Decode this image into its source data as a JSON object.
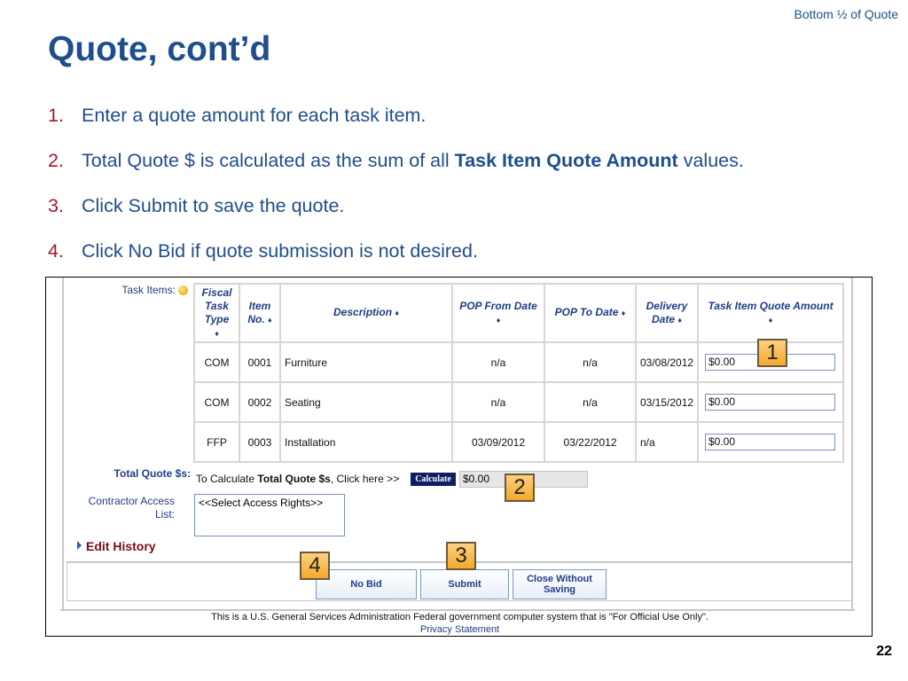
{
  "slide": {
    "section_note": "Bottom ½ of Quote",
    "title": "Quote, cont’d",
    "page_number": "22",
    "steps": [
      {
        "num": "1.",
        "text": "Enter a quote amount for each task item."
      },
      {
        "num": "2.",
        "text_before": "Total Quote $ is calculated as the sum of all ",
        "bold": "Task Item Quote Amount",
        "text_after": " values."
      },
      {
        "num": "3.",
        "text": "Click Submit to save the quote."
      },
      {
        "num": "4.",
        "text": "Click No Bid if quote submission is not desired."
      }
    ]
  },
  "form": {
    "task_items_label": "Task Items:",
    "columns": {
      "fiscal_task_type": "Fiscal Task Type",
      "item_no": "Item No.",
      "description": "Description",
      "pop_from": "POP From Date",
      "pop_to": "POP To Date",
      "delivery_date": "Delivery Date",
      "quote_amount": "Task Item Quote Amount",
      "sort_glyph": "♦"
    },
    "rows": [
      {
        "type": "COM",
        "item_no": "0001",
        "description": "Furniture",
        "pop_from": "n/a",
        "pop_to": "n/a",
        "delivery": "03/08/2012",
        "amount": "$0.00"
      },
      {
        "type": "COM",
        "item_no": "0002",
        "description": "Seating",
        "pop_from": "n/a",
        "pop_to": "n/a",
        "delivery": "03/15/2012",
        "amount": "$0.00"
      },
      {
        "type": "FFP",
        "item_no": "0003",
        "description": "Installation",
        "pop_from": "03/09/2012",
        "pop_to": "03/22/2012",
        "delivery": "n/a",
        "amount": "$0.00"
      }
    ],
    "total_label": "Total Quote $s:",
    "calc_prefix": "To Calculate ",
    "calc_bold": "Total Quote $s",
    "calc_suffix": ", Click here >>",
    "calculate_button": "Calculate",
    "total_value": "$0.00",
    "access_label_line1": "Contractor Access",
    "access_label_line2": "List:",
    "access_value": "<<Select Access Rights>>",
    "edit_history": "Edit History",
    "buttons": {
      "no_bid": "No Bid",
      "submit": "Submit",
      "close_line1": "Close Without",
      "close_line2": "Saving"
    },
    "footer_notice": "This is a U.S. General Services Administration Federal government computer system that is \"For Official Use Only\".",
    "privacy_link": "Privacy Statement"
  },
  "callouts": {
    "one": "1",
    "two": "2",
    "three": "3",
    "four": "4"
  },
  "colors": {
    "title": "#1f4e8c",
    "step_number": "#a3192c",
    "callout": "#f3a92c",
    "calculate_button": "#0c1f66",
    "edit_history": "#7a0c1c"
  }
}
